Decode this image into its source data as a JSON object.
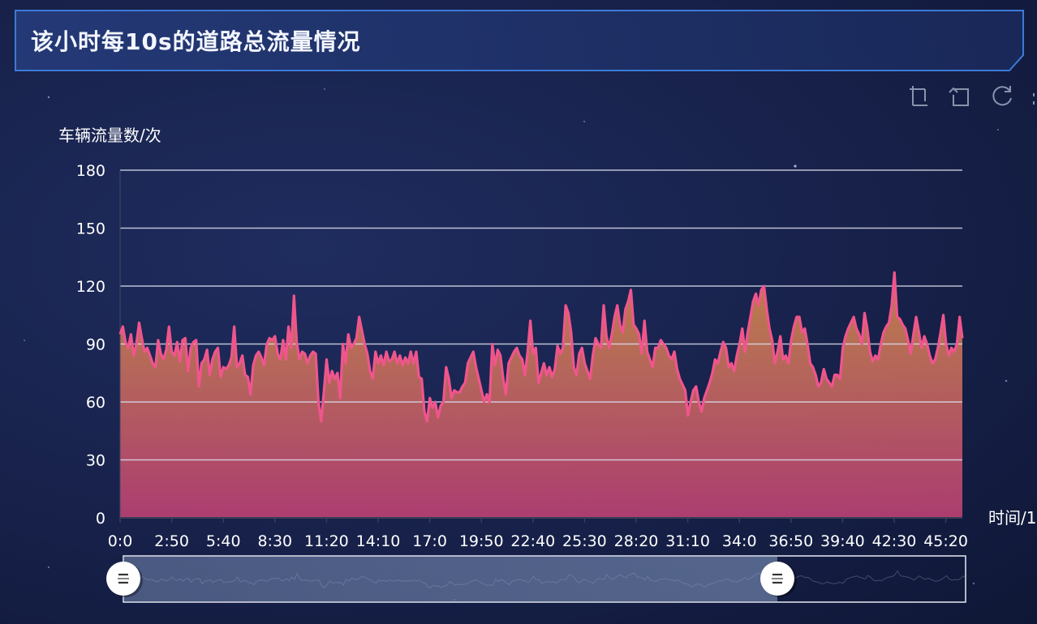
{
  "header": {
    "title": "该小时每10s的道路总流量情况"
  },
  "toolbar": {
    "icons": [
      "zoom-select-icon",
      "zoom-reset-icon",
      "refresh-icon",
      "save-image-icon"
    ]
  },
  "colors": {
    "line": "#f0558c",
    "area_top": "#c4864a",
    "area_bottom": "#b94074",
    "grid": "#d9dcea"
  },
  "chart_data": {
    "type": "area",
    "ylabel": "车辆流量数/次",
    "xlabel": "时间/1",
    "ylim": [
      0,
      180
    ],
    "yticks": [
      0,
      30,
      60,
      90,
      120,
      150,
      180
    ],
    "xticks": [
      "0:0",
      "2:50",
      "5:40",
      "8:30",
      "11:20",
      "14:10",
      "17:0",
      "19:50",
      "22:40",
      "25:30",
      "28:20",
      "31:10",
      "34:0",
      "36:50",
      "39:40",
      "42:30",
      "45:20"
    ],
    "grid": true,
    "x_interval_seconds": 10,
    "values": [
      95,
      99,
      91,
      88,
      95,
      84,
      90,
      101,
      93,
      86,
      88,
      84,
      80,
      78,
      92,
      85,
      82,
      87,
      99,
      86,
      84,
      91,
      81,
      92,
      93,
      76,
      88,
      91,
      92,
      68,
      80,
      82,
      87,
      74,
      82,
      86,
      88,
      73,
      78,
      77,
      79,
      83,
      99,
      78,
      80,
      84,
      74,
      73,
      64,
      79,
      84,
      86,
      83,
      79,
      90,
      93,
      92,
      94,
      85,
      82,
      92,
      82,
      99,
      88,
      115,
      91,
      82,
      86,
      85,
      80,
      84,
      86,
      85,
      60,
      50,
      65,
      82,
      70,
      76,
      72,
      75,
      62,
      90,
      80,
      95,
      88,
      90,
      93,
      104,
      97,
      90,
      85,
      76,
      72,
      86,
      80,
      84,
      79,
      86,
      81,
      82,
      86,
      80,
      84,
      79,
      83,
      80,
      86,
      80,
      86,
      73,
      72,
      55,
      50,
      62,
      57,
      60,
      52,
      58,
      60,
      78,
      72,
      62,
      66,
      65,
      65,
      68,
      70,
      80,
      83,
      86,
      78,
      72,
      66,
      60,
      64,
      60,
      90,
      79,
      87,
      84,
      72,
      64,
      80,
      83,
      86,
      88,
      84,
      82,
      74,
      86,
      102,
      85,
      88,
      70,
      75,
      80,
      74,
      78,
      73,
      77,
      89,
      85,
      88,
      110,
      106,
      96,
      78,
      74,
      85,
      88,
      80,
      76,
      72,
      84,
      93,
      90,
      88,
      110,
      94,
      88,
      95,
      104,
      110,
      100,
      96,
      108,
      112,
      118,
      100,
      98,
      95,
      85,
      102,
      86,
      82,
      78,
      88,
      88,
      92,
      90,
      88,
      84,
      82,
      86,
      77,
      72,
      69,
      66,
      53,
      60,
      66,
      68,
      60,
      55,
      62,
      66,
      70,
      75,
      82,
      80,
      86,
      91,
      88,
      78,
      80,
      76,
      84,
      90,
      98,
      86,
      96,
      104,
      112,
      116,
      110,
      118,
      120,
      108,
      98,
      92,
      80,
      86,
      94,
      82,
      84,
      80,
      92,
      99,
      104,
      104,
      96,
      98,
      90,
      80,
      78,
      74,
      68,
      70,
      77,
      72,
      70,
      68,
      74,
      74,
      72,
      88,
      94,
      98,
      101,
      104,
      98,
      95,
      90,
      106,
      98,
      86,
      81,
      84,
      82,
      90,
      96,
      99,
      101,
      110,
      127,
      104,
      103,
      100,
      98,
      92,
      85,
      95,
      104,
      96,
      88,
      94,
      90,
      84,
      80,
      82,
      88,
      96,
      105,
      90,
      84,
      88,
      86,
      90,
      104,
      93
    ]
  }
}
